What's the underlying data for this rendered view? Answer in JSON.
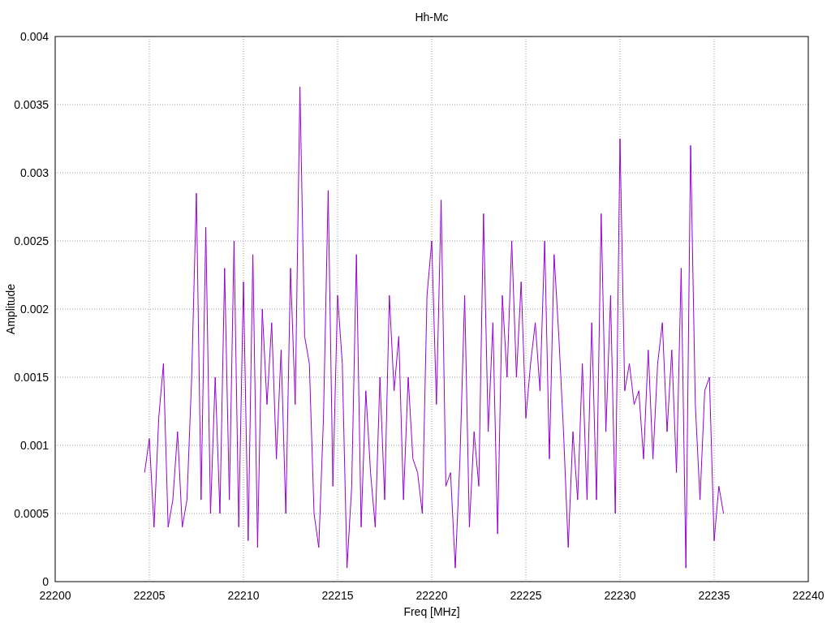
{
  "chart": {
    "chart_data": {
      "type": "line",
      "title": "Hh-Mc",
      "xlabel": "Freq [MHz]",
      "ylabel": "Amplitude",
      "x": [
        22204.75,
        22205,
        22205.25,
        22205.5,
        22205.75,
        22206,
        22206.25,
        22206.5,
        22206.75,
        22207,
        22207.25,
        22207.5,
        22207.75,
        22208,
        22208.25,
        22208.5,
        22208.75,
        22209,
        22209.25,
        22209.5,
        22209.75,
        22210,
        22210.25,
        22210.5,
        22210.75,
        22211,
        22211.25,
        22211.5,
        22211.75,
        22212,
        22212.25,
        22212.5,
        22212.75,
        22213,
        22213.25,
        22213.5,
        22213.75,
        22214,
        22214.25,
        22214.5,
        22214.75,
        22215,
        22215.25,
        22215.5,
        22215.75,
        22216,
        22216.25,
        22216.5,
        22216.75,
        22217,
        22217.25,
        22217.5,
        22217.75,
        22218,
        22218.25,
        22218.5,
        22218.75,
        22219,
        22219.25,
        22219.5,
        22219.75,
        22220,
        22220.25,
        22220.5,
        22220.75,
        22221,
        22221.25,
        22221.5,
        22221.75,
        22222,
        22222.25,
        22222.5,
        22222.75,
        22223,
        22223.25,
        22223.5,
        22223.75,
        22224,
        22224.25,
        22224.5,
        22224.75,
        22225,
        22225.25,
        22225.5,
        22225.75,
        22226,
        22226.25,
        22226.5,
        22226.75,
        22227,
        22227.25,
        22227.5,
        22227.75,
        22228,
        22228.25,
        22228.5,
        22228.75,
        22229,
        22229.25,
        22229.5,
        22229.75,
        22230,
        22230.25,
        22230.5,
        22230.75,
        22231,
        22231.25,
        22231.5,
        22231.75,
        22232,
        22232.25,
        22232.5,
        22232.75,
        22233,
        22233.25,
        22233.5,
        22233.75,
        22234,
        22234.25,
        22234.5,
        22234.75,
        22235,
        22235.25,
        22235.5
      ],
      "series": [
        {
          "color": "#9400d3",
          "values": [
            0.0008,
            0.00105,
            0.0004,
            0.0012,
            0.0016,
            0.0004,
            0.0006,
            0.0011,
            0.0004,
            0.0006,
            0.0015,
            0.00285,
            0.0006,
            0.0026,
            0.0005,
            0.0015,
            0.0005,
            0.0023,
            0.0006,
            0.0025,
            0.0004,
            0.0022,
            0.0003,
            0.0024,
            0.00025,
            0.002,
            0.0013,
            0.0019,
            0.0009,
            0.0017,
            0.0005,
            0.0023,
            0.0013,
            0.00363,
            0.0018,
            0.0016,
            0.0005,
            0.00025,
            0.0012,
            0.00287,
            0.0007,
            0.0021,
            0.0016,
            0.0001,
            0.0007,
            0.0024,
            0.0004,
            0.0014,
            0.0008,
            0.0004,
            0.0015,
            0.0006,
            0.0021,
            0.0014,
            0.0018,
            0.0006,
            0.0015,
            0.0009,
            0.0008,
            0.0005,
            0.0021,
            0.0025,
            0.0013,
            0.0028,
            0.0007,
            0.0008,
            0.0001,
            0.0009,
            0.0021,
            0.0004,
            0.0011,
            0.0007,
            0.0027,
            0.0011,
            0.0019,
            0.00035,
            0.0021,
            0.0015,
            0.0025,
            0.0015,
            0.0022,
            0.0012,
            0.0016,
            0.0019,
            0.0014,
            0.0025,
            0.0009,
            0.0024,
            0.0018,
            0.0011,
            0.00025,
            0.0011,
            0.0006,
            0.0016,
            0.0006,
            0.0019,
            0.0006,
            0.0027,
            0.0011,
            0.0021,
            0.0005,
            0.00325,
            0.0014,
            0.0016,
            0.0013,
            0.0014,
            0.0009,
            0.0017,
            0.0009,
            0.0016,
            0.0019,
            0.0011,
            0.0017,
            0.0008,
            0.0023,
            0.0001,
            0.0032,
            0.0013,
            0.0006,
            0.0014,
            0.0015,
            0.0003,
            0.0007,
            0.0005
          ]
        }
      ],
      "grid": true,
      "xlim": [
        22200,
        22240
      ],
      "ylim": [
        0,
        0.004
      ],
      "xticks": [
        22200,
        22205,
        22210,
        22215,
        22220,
        22225,
        22230,
        22235,
        22240
      ],
      "yticks": [
        0,
        0.0005,
        0.001,
        0.0015,
        0.002,
        0.0025,
        0.003,
        0.0035,
        0.004
      ]
    }
  }
}
